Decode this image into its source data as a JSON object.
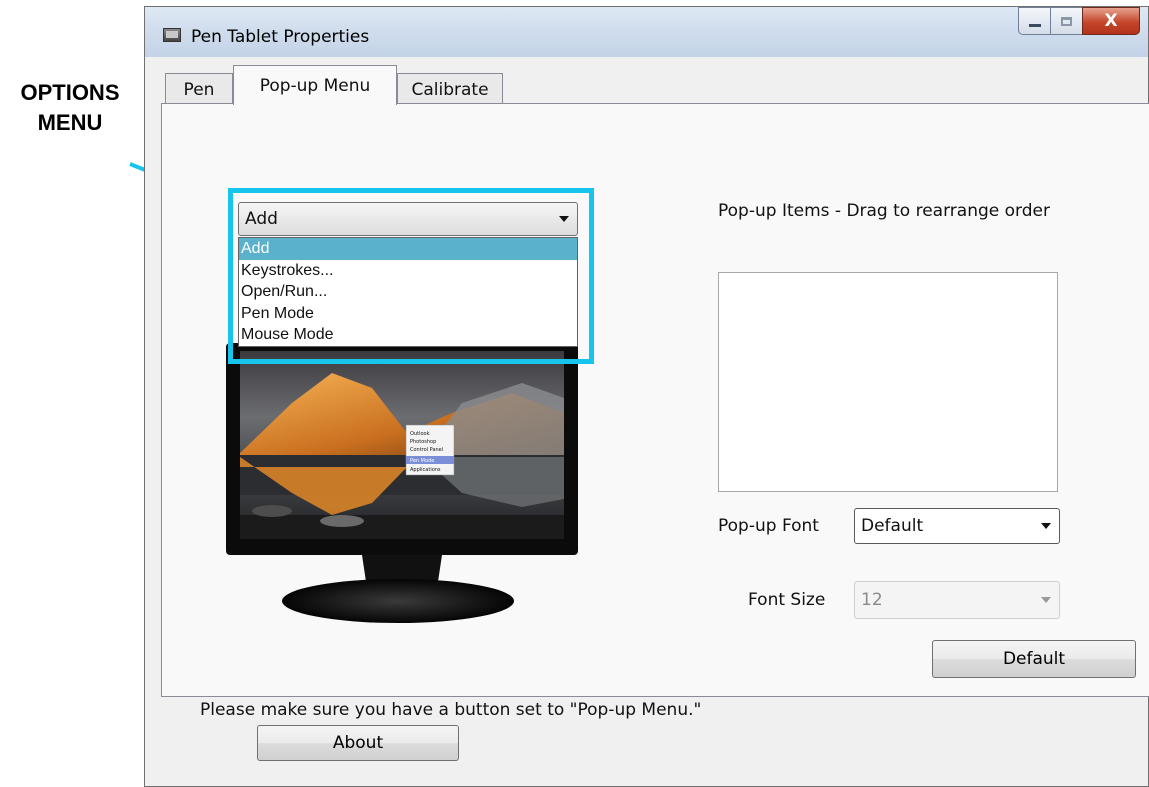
{
  "annotation": {
    "callout_line1": "OPTIONS",
    "callout_line2": "MENU",
    "highlight_color": "#17c4ec"
  },
  "window": {
    "title": "Pen Tablet Properties",
    "controls": {
      "minimize": "▭",
      "maximize": "□",
      "close": "X"
    }
  },
  "tabs": [
    {
      "label": "Pen"
    },
    {
      "label": "Pop-up Menu"
    },
    {
      "label": "Calibrate"
    }
  ],
  "options_menu": {
    "selected": "Add",
    "options": [
      "Add",
      "Keystrokes...",
      "Open/Run...",
      "Pen Mode",
      "Mouse Mode"
    ]
  },
  "monitor_preview": {
    "menu_items": [
      "Outlook",
      "Photoshop",
      "Control Panel",
      "Pen Mode",
      "Applications"
    ]
  },
  "popup_items": {
    "label": "Pop-up Items - Drag to rearrange order"
  },
  "popup_font": {
    "label": "Pop-up Font",
    "value": "Default"
  },
  "font_size": {
    "label": "Font Size",
    "value": "12"
  },
  "default_button": "Default",
  "note": "Please make sure you have a button set to \"Pop-up Menu.\"",
  "about_button": "About",
  "colors": {
    "selection": "#5ab1cc",
    "highlight": "#17c4ec"
  }
}
